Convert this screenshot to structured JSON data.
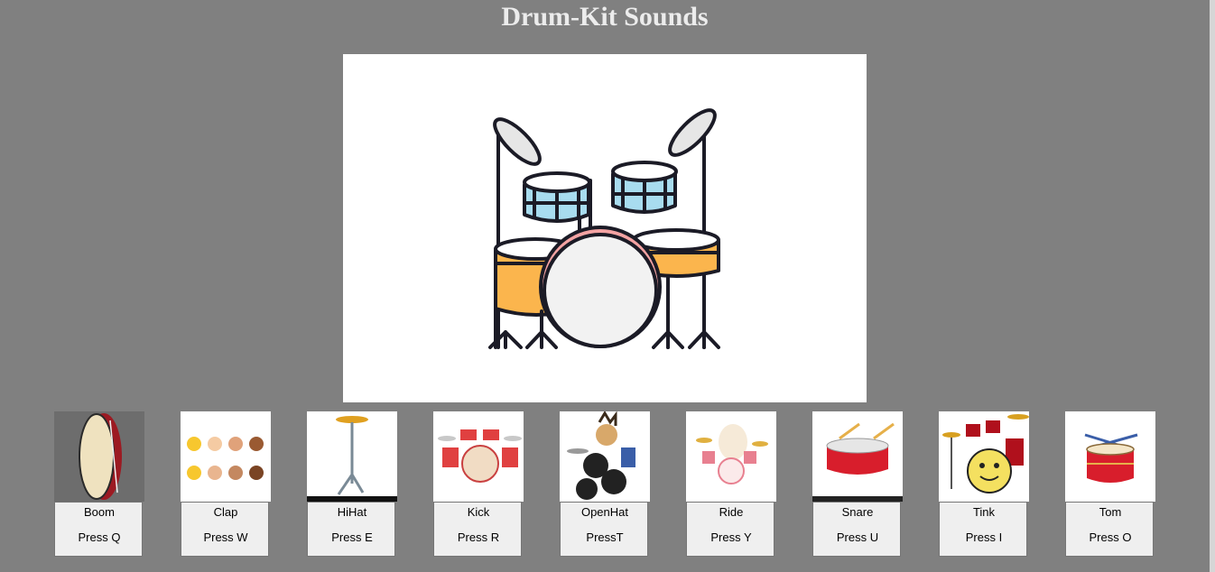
{
  "title": "Drum-Kit Sounds",
  "pads": [
    {
      "name": "Boom",
      "hint": "Press Q",
      "icon": "tambourine-drum-icon"
    },
    {
      "name": "Clap",
      "hint": "Press W",
      "icon": "clapping-hands-icon"
    },
    {
      "name": "HiHat",
      "hint": "Press E",
      "icon": "hihat-stand-icon"
    },
    {
      "name": "Kick",
      "hint": "Press R",
      "icon": "red-drum-kit-icon"
    },
    {
      "name": "OpenHat",
      "hint": "PressT",
      "icon": "cartoon-drummer-icon"
    },
    {
      "name": "Ride",
      "hint": "Press Y",
      "icon": "ride-drum-kit-icon"
    },
    {
      "name": "Snare",
      "hint": "Press U",
      "icon": "snare-drum-icon"
    },
    {
      "name": "Tink",
      "hint": "Press I",
      "icon": "smiling-drum-kit-icon"
    },
    {
      "name": "Tom",
      "hint": "Press O",
      "icon": "tom-drum-icon"
    }
  ],
  "colors": {
    "background": "#808080",
    "drum_orange": "#fbb54d",
    "drum_blue": "#a8dcef",
    "drum_red": "#d81e2c"
  }
}
